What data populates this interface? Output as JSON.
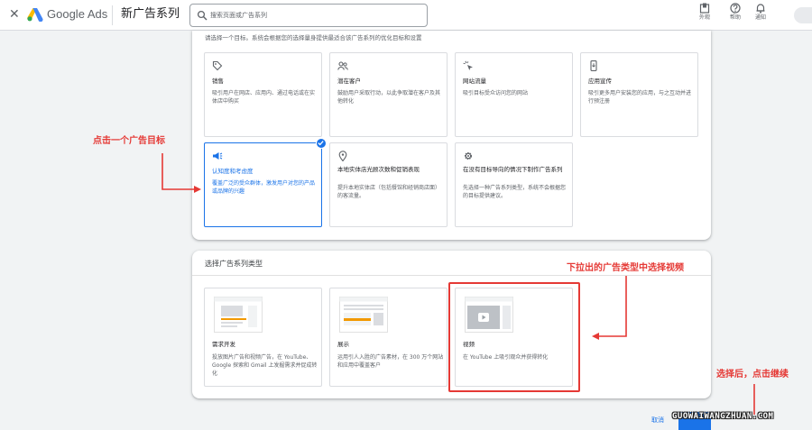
{
  "header": {
    "close_glyph": "✕",
    "brand": "Google Ads",
    "title": "新广告系列",
    "search_placeholder": "搜索页面或广告系列",
    "tools": [
      {
        "label": "外观",
        "icon": "appearance-icon"
      },
      {
        "label": "帮助",
        "icon": "help-icon"
      },
      {
        "label": "通知",
        "icon": "bell-icon"
      }
    ]
  },
  "goal_panel": {
    "intro": "请选择一个目标。系统会根据您的选择量身提供最适合该广告系列的优化目标和设置",
    "cards": [
      {
        "title": "销售",
        "desc": "吸引用户在网店、应用内、通过电话或在实体店中购买",
        "icon": "tag-icon"
      },
      {
        "title": "潜在客户",
        "desc": "鼓励用户采取行动，以此争取潜在客户及其他转化",
        "icon": "people-icon"
      },
      {
        "title": "网站流量",
        "desc": "吸引目标受众访问您的网站",
        "icon": "click-icon"
      },
      {
        "title": "应用宣传",
        "desc": "吸引更多用户安装您的应用，与之互动并进行预注册",
        "icon": "phone-icon"
      },
      {
        "title": "认知度和考虑度",
        "desc": "覆盖广泛的受众群体，激发用户对您的产品或品牌的兴趣",
        "icon": "megaphone-icon",
        "selected": true
      },
      {
        "title": "本地实体店光顾次数和促销表现",
        "desc": "提升本地实体店（包括餐馆和经销商店面）的客流量。",
        "icon": "location-pin-icon"
      },
      {
        "title": "在没有目标导向的情况下制作广告系列",
        "desc": "先选择一种广告系列类型，系统不会根据您的目标提供建议。",
        "icon": "gear-icon"
      }
    ]
  },
  "type_panel": {
    "heading": "选择广告系列类型",
    "cards": [
      {
        "title": "需求开发",
        "desc": "投放图片广告和视频广告，在 YouTube、Google 探索和 Gmail 上发掘需求并促成转化"
      },
      {
        "title": "展示",
        "desc": "运用引人入胜的广告素材，在 300 万个网站和应用中覆盖客户"
      },
      {
        "title": "视频",
        "desc": "在 YouTube 上吸引观众并获得转化"
      }
    ]
  },
  "annotations": {
    "click_goal": "点击一个广告目标",
    "choose_video": "下拉出的广告类型中选择视频",
    "then_continue": "选择后，点击继续"
  },
  "footer": {
    "cancel_label": "取消",
    "watermark": "GUOWAIWANGZHUAN.COM"
  },
  "colors": {
    "accent": "#1a73e8",
    "annotation_red": "#e53935"
  }
}
